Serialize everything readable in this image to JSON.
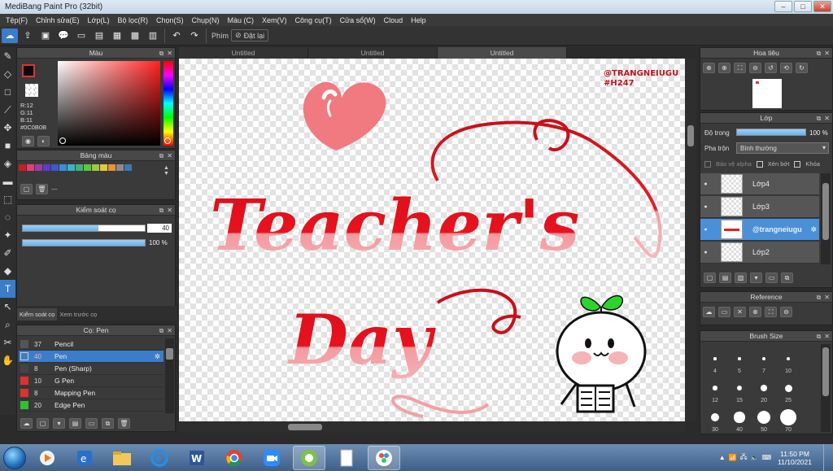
{
  "window": {
    "title": "MediBang Paint Pro (32bit)",
    "min": "–",
    "max": "□",
    "close": "✕"
  },
  "menu": [
    "Tệp(F)",
    "Chỉnh sửa(E)",
    "Lớp(L)",
    "Bộ lọc(R)",
    "Chọn(S)",
    "Chụp(N)",
    "Màu (C)",
    "Xem(V)",
    "Công cụ(T)",
    "Cửa sổ(W)",
    "Cloud",
    "Help"
  ],
  "toolbar": {
    "snap_label": "Phím",
    "reset_label": "Đặt lại"
  },
  "color_panel": {
    "title": "Màu",
    "r": "R:12",
    "g": "G:11",
    "b": "B:11",
    "hex": "#0C0B0B",
    "primary": "#0C0B0B",
    "secondary": "#ffffff"
  },
  "palette_panel": {
    "title": "Bảng màu",
    "extra": "---",
    "colors": [
      "#c81e1e",
      "#e83c78",
      "#a03ca0",
      "#5a3cc8",
      "#3c5ac8",
      "#3c8cdc",
      "#3cb4c8",
      "#3cb478",
      "#5ac83c",
      "#a0c83c",
      "#e6c83c",
      "#e69632",
      "#8c8c8c",
      "#3c78b4"
    ]
  },
  "brush_control": {
    "title": "Kiểm soát cọ",
    "size": "40",
    "size_fraction": 0.62,
    "opacity": "100 %",
    "opacity_fraction": 1.0,
    "tab1": "Kiểm soát cọ",
    "tab2": "Xem trước cọ"
  },
  "brush_panel": {
    "title": "Cọ: Pen",
    "items": [
      {
        "size": "37",
        "name": "Pencil",
        "color": "#555555",
        "selected": false
      },
      {
        "size": "40",
        "name": "Pen",
        "color": "#3b7dc9",
        "selected": true
      },
      {
        "size": "8",
        "name": "Pen (Sharp)",
        "color": "#444444",
        "selected": false
      },
      {
        "size": "10",
        "name": "G Pen",
        "color": "#e03030",
        "selected": false
      },
      {
        "size": "8",
        "name": "Mapping Pen",
        "color": "#e03030",
        "selected": false
      },
      {
        "size": "20",
        "name": "Edge Pen",
        "color": "#30c030",
        "selected": false
      }
    ]
  },
  "tabs": [
    "Untitled",
    "Untitled",
    "Untitled"
  ],
  "canvas": {
    "watermark1": "@TRANGNEIUGU",
    "watermark2": "#H247",
    "text1": "Teacher's",
    "text2": "Day"
  },
  "navigator": {
    "title": "Hoa tiêu"
  },
  "layer_panel": {
    "title": "Lớp",
    "opacity_label": "Độ trong",
    "opacity_value": "100 %",
    "opacity_fraction": 1.0,
    "blend_label": "Pha trộn",
    "blend_value": "Bình thường",
    "protect_alpha": "Bảo vệ alpha",
    "clipping": "Xén bớt",
    "lock": "Khóa",
    "layers": [
      {
        "name": "Lớp4",
        "selected": false
      },
      {
        "name": "Lớp3",
        "selected": false
      },
      {
        "name": "@trangneiugu",
        "selected": true
      },
      {
        "name": "Lớp2",
        "selected": false
      }
    ]
  },
  "reference_panel": {
    "title": "Reference"
  },
  "brush_size_panel": {
    "title": "Brush Size",
    "sizes": [
      "4",
      "5",
      "7",
      "10",
      "12",
      "15",
      "20",
      "25",
      "30",
      "40",
      "50",
      "70"
    ]
  },
  "taskbar": {
    "time": "11:50 PM",
    "date": "11/10/2021"
  }
}
